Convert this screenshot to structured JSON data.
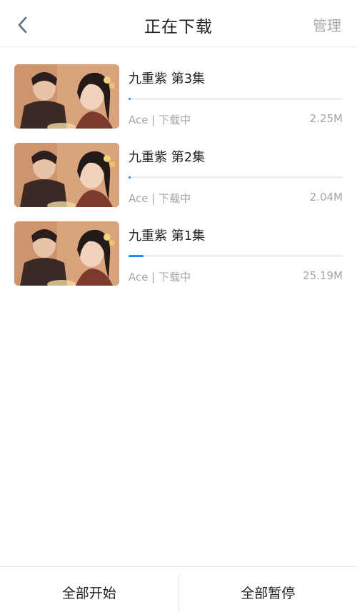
{
  "header": {
    "title": "正在下载",
    "manage_label": "管理"
  },
  "downloads": [
    {
      "title": "九重紫 第3集",
      "source": "Ace",
      "status": "下载中",
      "size": "2.25M",
      "progress": 0.01
    },
    {
      "title": "九重紫 第2集",
      "source": "Ace",
      "status": "下载中",
      "size": "2.04M",
      "progress": 0.01
    },
    {
      "title": "九重紫 第1集",
      "source": "Ace",
      "status": "下载中",
      "size": "25.19M",
      "progress": 0.07
    }
  ],
  "footer": {
    "start_all_label": "全部开始",
    "pause_all_label": "全部暂停"
  },
  "colors": {
    "accent": "#1e88ff",
    "muted_text": "#a5a5a5",
    "back_icon": "#5b7287"
  },
  "icons": {
    "back": "chevron-left-icon"
  }
}
